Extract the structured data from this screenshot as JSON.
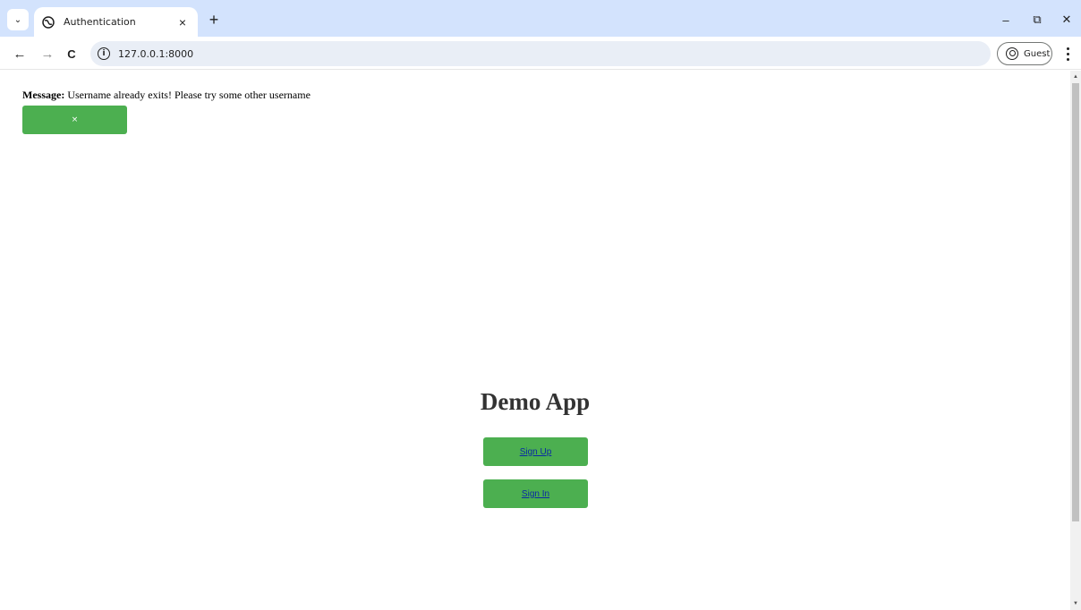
{
  "browser": {
    "tab": {
      "title": "Authentication",
      "close_glyph": "×",
      "favicon": "globe-icon"
    },
    "new_tab_glyph": "+",
    "window_controls": {
      "minimize": "–",
      "restore": "⧉",
      "close": "✕"
    },
    "nav": {
      "back": "←",
      "forward": "→",
      "reload": "C"
    },
    "address": {
      "url": "127.0.0.1:8000",
      "info_glyph": "i"
    },
    "profile": {
      "label": "Guest"
    },
    "tab_search_glyph": "⌄"
  },
  "page": {
    "message": {
      "label": "Message:",
      "text": "Username already exits! Please try some other username"
    },
    "dismiss_button": {
      "label": "×"
    },
    "title": "Demo App",
    "buttons": [
      {
        "label": "Sign Up"
      },
      {
        "label": "Sign In"
      }
    ]
  },
  "colors": {
    "tabstrip": "#d3e3fd",
    "omnibox": "#e9eef6",
    "button_green": "#4caf50",
    "link_blue": "#0a2aa3",
    "title_text": "#333333"
  },
  "scrollbar": {
    "up": "▲",
    "down": "▼"
  }
}
